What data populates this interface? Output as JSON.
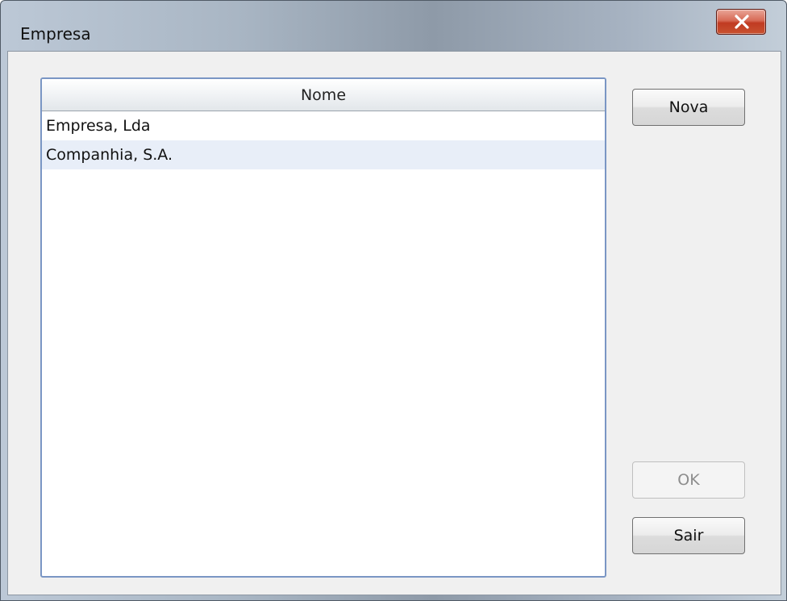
{
  "window": {
    "title": "Empresa"
  },
  "table": {
    "columns": [
      "Nome"
    ],
    "rows": [
      {
        "nome": "Empresa, Lda"
      },
      {
        "nome": "Companhia, S.A."
      }
    ]
  },
  "buttons": {
    "nova": "Nova",
    "ok": "OK",
    "sair": "Sair"
  },
  "icons": {
    "close": "close-icon"
  },
  "colors": {
    "close_button": "#c8422a",
    "row_alt": "#e8eef8",
    "table_border": "#7a96c4"
  }
}
